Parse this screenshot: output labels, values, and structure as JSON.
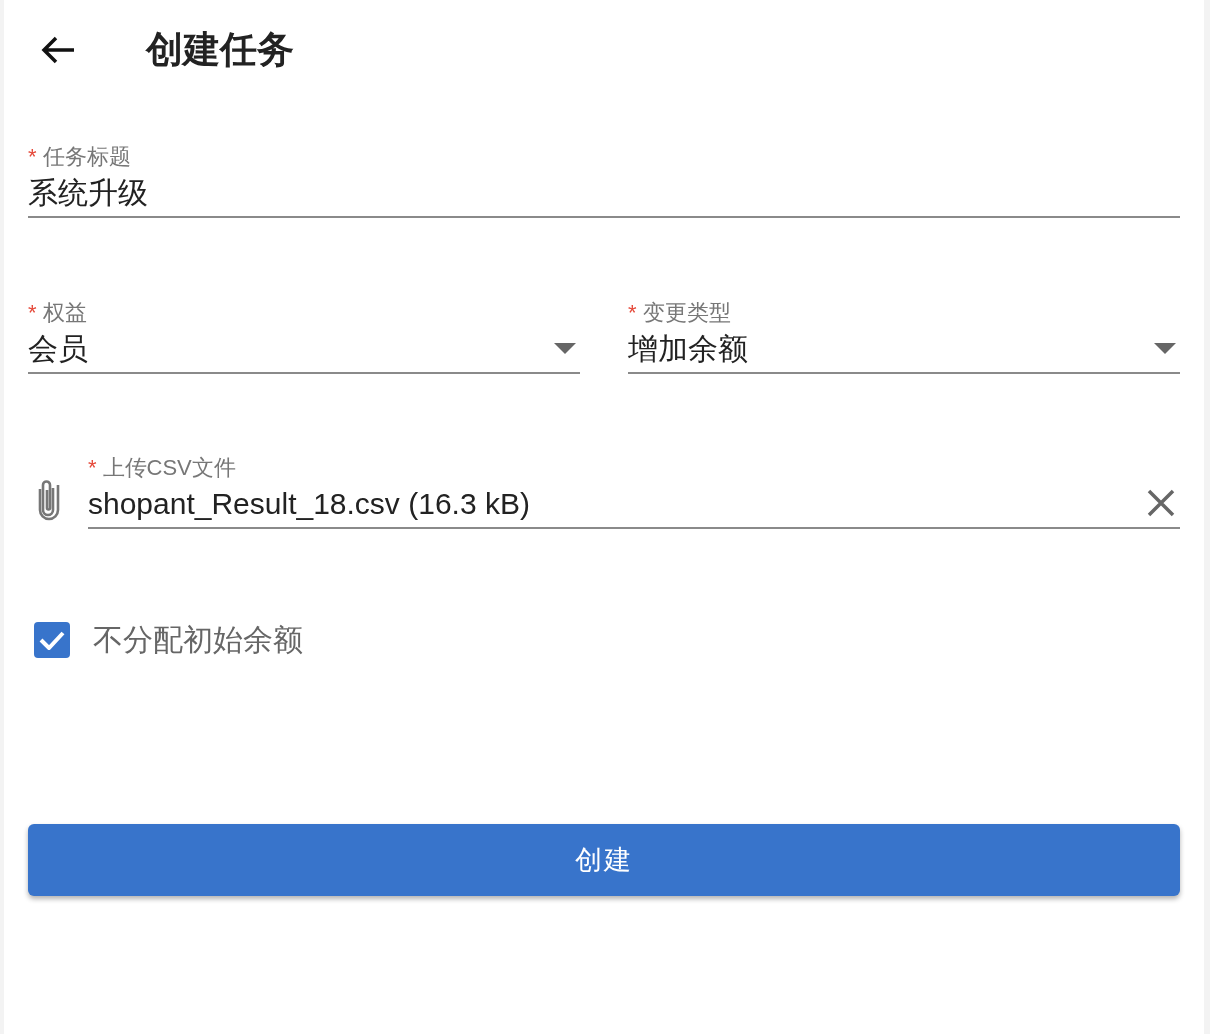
{
  "header": {
    "title": "创建任务"
  },
  "title_field": {
    "required_mark": "*",
    "label": "任务标题",
    "value": "系统升级"
  },
  "selects": [
    {
      "required_mark": "*",
      "label": "权益",
      "value": "会员"
    },
    {
      "required_mark": "*",
      "label": "变更类型",
      "value": "增加余额"
    }
  ],
  "file_field": {
    "required_mark": "*",
    "label": "上传CSV文件",
    "value": "shopant_Result_18.csv (16.3 kB)"
  },
  "checkbox": {
    "label": "不分配初始余额",
    "checked": true
  },
  "submit_button": {
    "label": "创建"
  }
}
